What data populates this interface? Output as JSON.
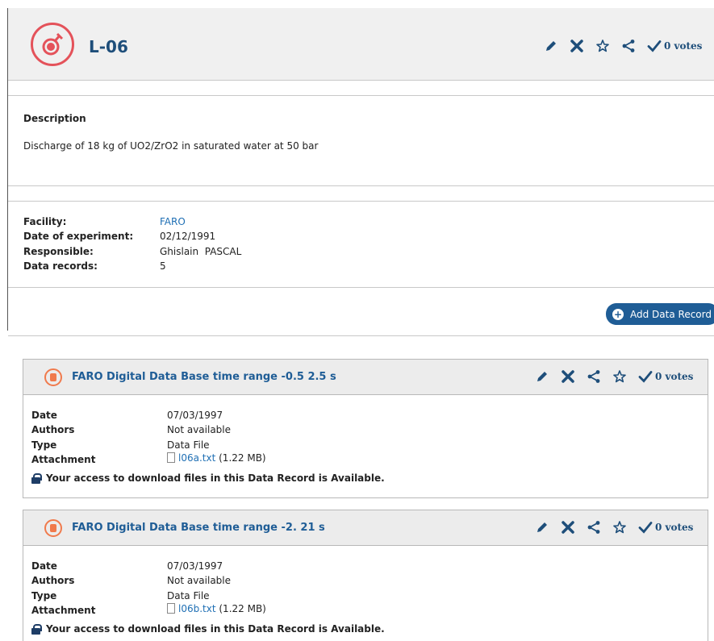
{
  "header": {
    "title": "L-06",
    "votes_label": "0 votes",
    "logo_icon": "flask-icon",
    "accent_color": "#e4525a"
  },
  "description": {
    "label": "Description",
    "text": "Discharge of 18 kg of UO2/ZrO2 in saturated water at 50 bar"
  },
  "details": [
    {
      "label": "Facility:",
      "value": "FARO",
      "is_link": true
    },
    {
      "label": "Date of experiment:",
      "value": "02/12/1991",
      "is_link": false
    },
    {
      "label": "Responsible:",
      "value": "Ghislain  PASCAL",
      "is_link": false
    },
    {
      "label": "Data records:",
      "value": "5",
      "is_link": false
    }
  ],
  "add_button": {
    "label": "Add Data Record"
  },
  "records": [
    {
      "title": "FARO Digital Data Base time range -0.5 2.5 s",
      "votes_label": "0 votes",
      "rows": [
        {
          "label": "Date",
          "value": "07/03/1997"
        },
        {
          "label": "Authors",
          "value": "Not available"
        },
        {
          "label": "Type",
          "value": "Data File"
        },
        {
          "label": "Attachment",
          "file": "l06a.txt",
          "size": "(1.22 MB)"
        }
      ],
      "access": "Your access to download files in this Data Record is Available."
    },
    {
      "title": "FARO Digital Data Base time range -2. 21 s",
      "votes_label": "0 votes",
      "rows": [
        {
          "label": "Date",
          "value": "07/03/1997"
        },
        {
          "label": "Authors",
          "value": "Not available"
        },
        {
          "label": "Type",
          "value": "Data File"
        },
        {
          "label": "Attachment",
          "file": "l06b.txt",
          "size": "(1.22 MB)"
        }
      ],
      "access": "Your access to download files in this Data Record is Available."
    }
  ]
}
